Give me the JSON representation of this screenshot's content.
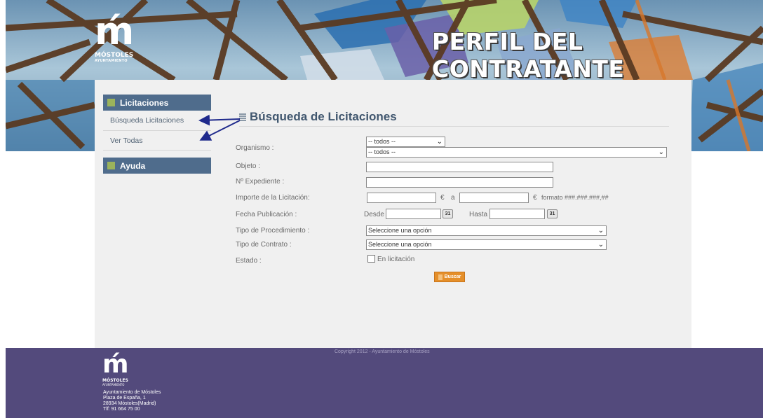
{
  "banner": {
    "logo_name": "MÓSTOLES",
    "logo_sub": "AYUNTAMIENTO",
    "title": "PERFIL DEL CONTRATANTE"
  },
  "sidebar": {
    "section1": "Licitaciones",
    "items": [
      "Búsqueda Licitaciones",
      "Ver Todas"
    ],
    "section2": "Ayuda"
  },
  "page": {
    "title": "Búsqueda de Licitaciones"
  },
  "form": {
    "organismo_label": "Organismo :",
    "organismo_value1": "-- todos --",
    "organismo_value2": "-- todos --",
    "objeto_label": "Objeto :",
    "expediente_label": "Nº Expediente :",
    "importe_label": "Importe de la Licitación:",
    "euro1": "€",
    "a": "a",
    "euro2": "€",
    "formato": "formato ###.###.###,##",
    "fecha_label": "Fecha Publicación :",
    "desde": "Desde",
    "hasta": "Hasta",
    "cal_icon_text": "31",
    "procedimiento_label": "Tipo de Procedimiento :",
    "procedimiento_value": "Seleccione una opción",
    "contrato_label": "Tipo de Contrato :",
    "contrato_value": "Seleccione una opción",
    "estado_label": "Estado :",
    "estado_option": "En licitación",
    "buscar": "Buscar"
  },
  "footer": {
    "copyright": "Copyright 2012 - Ayuntamiento de Móstoles",
    "logo_name": "MÓSTOLES",
    "logo_sub": "AYUNTAMIENTO",
    "address": [
      "Ayuntamiento de Móstoles",
      "Plaza de España, 1",
      "28934 Móstoles(Madrid)",
      "Tlf: 91 664 75 00"
    ]
  },
  "colors": {
    "sidebar_header": "#4f6c8c",
    "accent_square": "#9bb35b",
    "footer": "#534a7c",
    "button": "#e58f2a",
    "annotation_arrow": "#1f2a8c"
  }
}
